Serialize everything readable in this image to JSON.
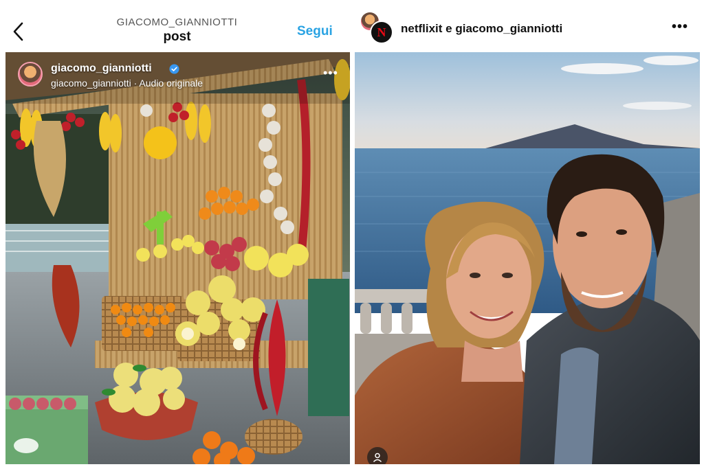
{
  "left": {
    "header": {
      "username": "GIACOMO_GIANNIOTTI",
      "title": "post",
      "follow_label": "Segui",
      "back_icon": "chevron-left-icon"
    },
    "post": {
      "author": "giacomo_gianniotti",
      "subtitle": "giacomo_gianniotti · Audio originale",
      "verified": true,
      "more_icon": "ellipsis-icon",
      "more_label": "•••"
    }
  },
  "right": {
    "header": {
      "coauthors": "netflixit e giacomo_gianniotti",
      "netflix_logo": "N",
      "more_label": "•••"
    },
    "post": {
      "tag_icon": "person-tag-icon"
    }
  },
  "colors": {
    "follow": "#2aa3e3",
    "verified": "#3897f0",
    "netflix_red": "#e50914"
  }
}
